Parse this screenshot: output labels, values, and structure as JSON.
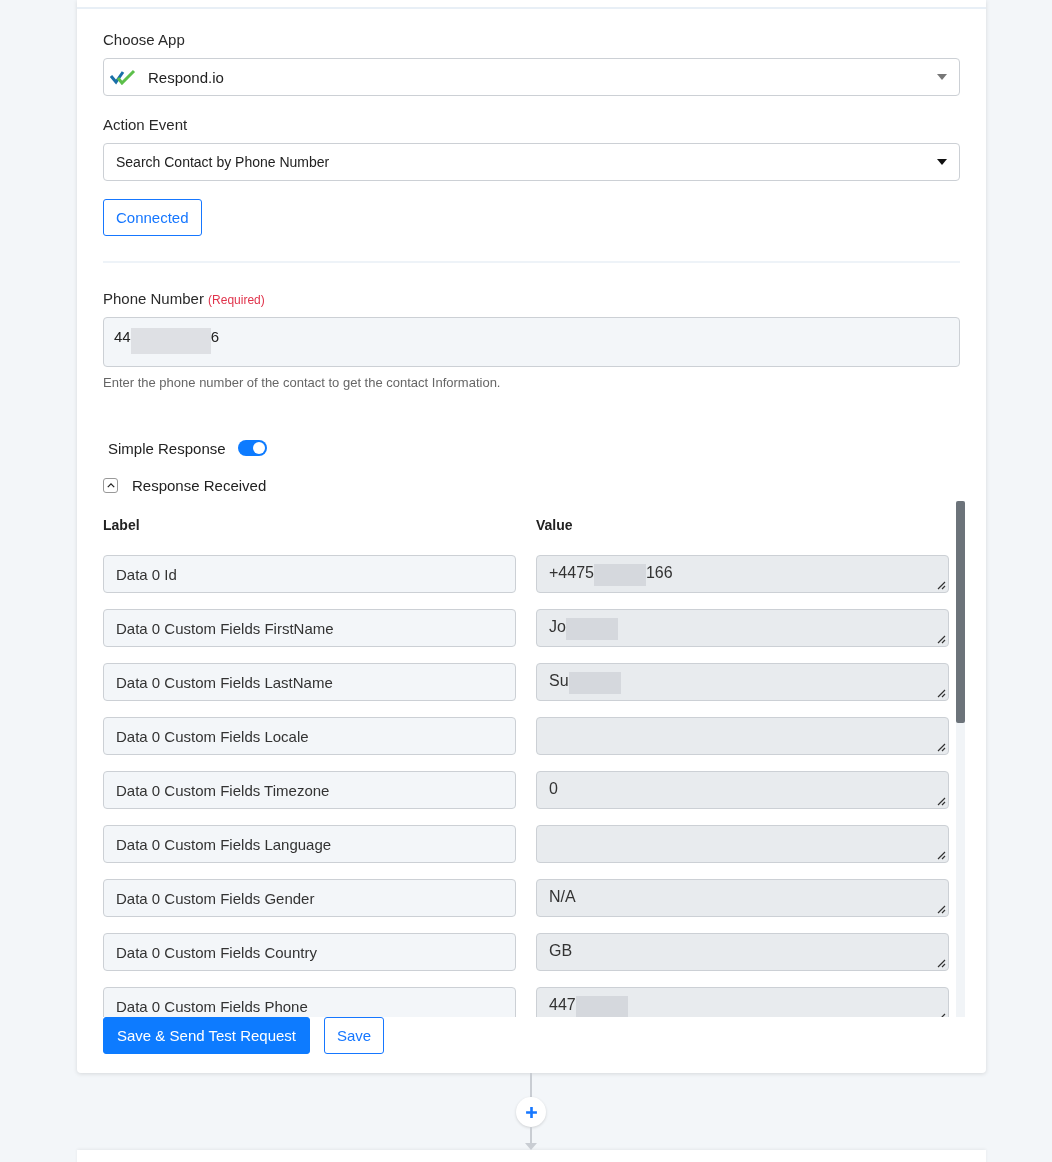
{
  "choose_app": {
    "label": "Choose App",
    "value": "Respond.io"
  },
  "action_event": {
    "label": "Action Event",
    "value": "Search Contact by Phone Number"
  },
  "connection_button": "Connected",
  "phone": {
    "label": "Phone Number",
    "required": "(Required)",
    "value": "44",
    "value_end": "6",
    "redacted": true,
    "hint": "Enter the phone number of the contact to get the contact Information."
  },
  "simple_response": {
    "label": "Simple Response",
    "on": true
  },
  "response": {
    "label": "Response Received",
    "expanded": true,
    "columns": [
      "Label",
      "Value"
    ],
    "rows": [
      {
        "label": "Data 0 Id",
        "value": "+4475",
        "value_end": "166",
        "redacted": true
      },
      {
        "label": "Data 0 Custom Fields FirstName",
        "value": "Jo",
        "redacted": true
      },
      {
        "label": "Data 0 Custom Fields LastName",
        "value": "Su",
        "redacted": true
      },
      {
        "label": "Data 0 Custom Fields Locale",
        "redacted": false
      },
      {
        "label": "Data 0 Custom Fields Timezone",
        "value": "0",
        "redacted": false
      },
      {
        "label": "Data 0 Custom Fields Language",
        "redacted": false
      },
      {
        "label": "Data 0 Custom Fields Gender",
        "value": "N/A",
        "redacted": false
      },
      {
        "label": "Data 0 Custom Fields Country",
        "value": "GB",
        "redacted": false
      },
      {
        "label": "Data 0 Custom Fields Phone",
        "value": "447",
        "redacted": true
      }
    ]
  },
  "buttons": [
    {
      "label": "Save & Send Test Request",
      "kind": "primary"
    },
    {
      "label": "Save",
      "kind": "outline"
    }
  ]
}
